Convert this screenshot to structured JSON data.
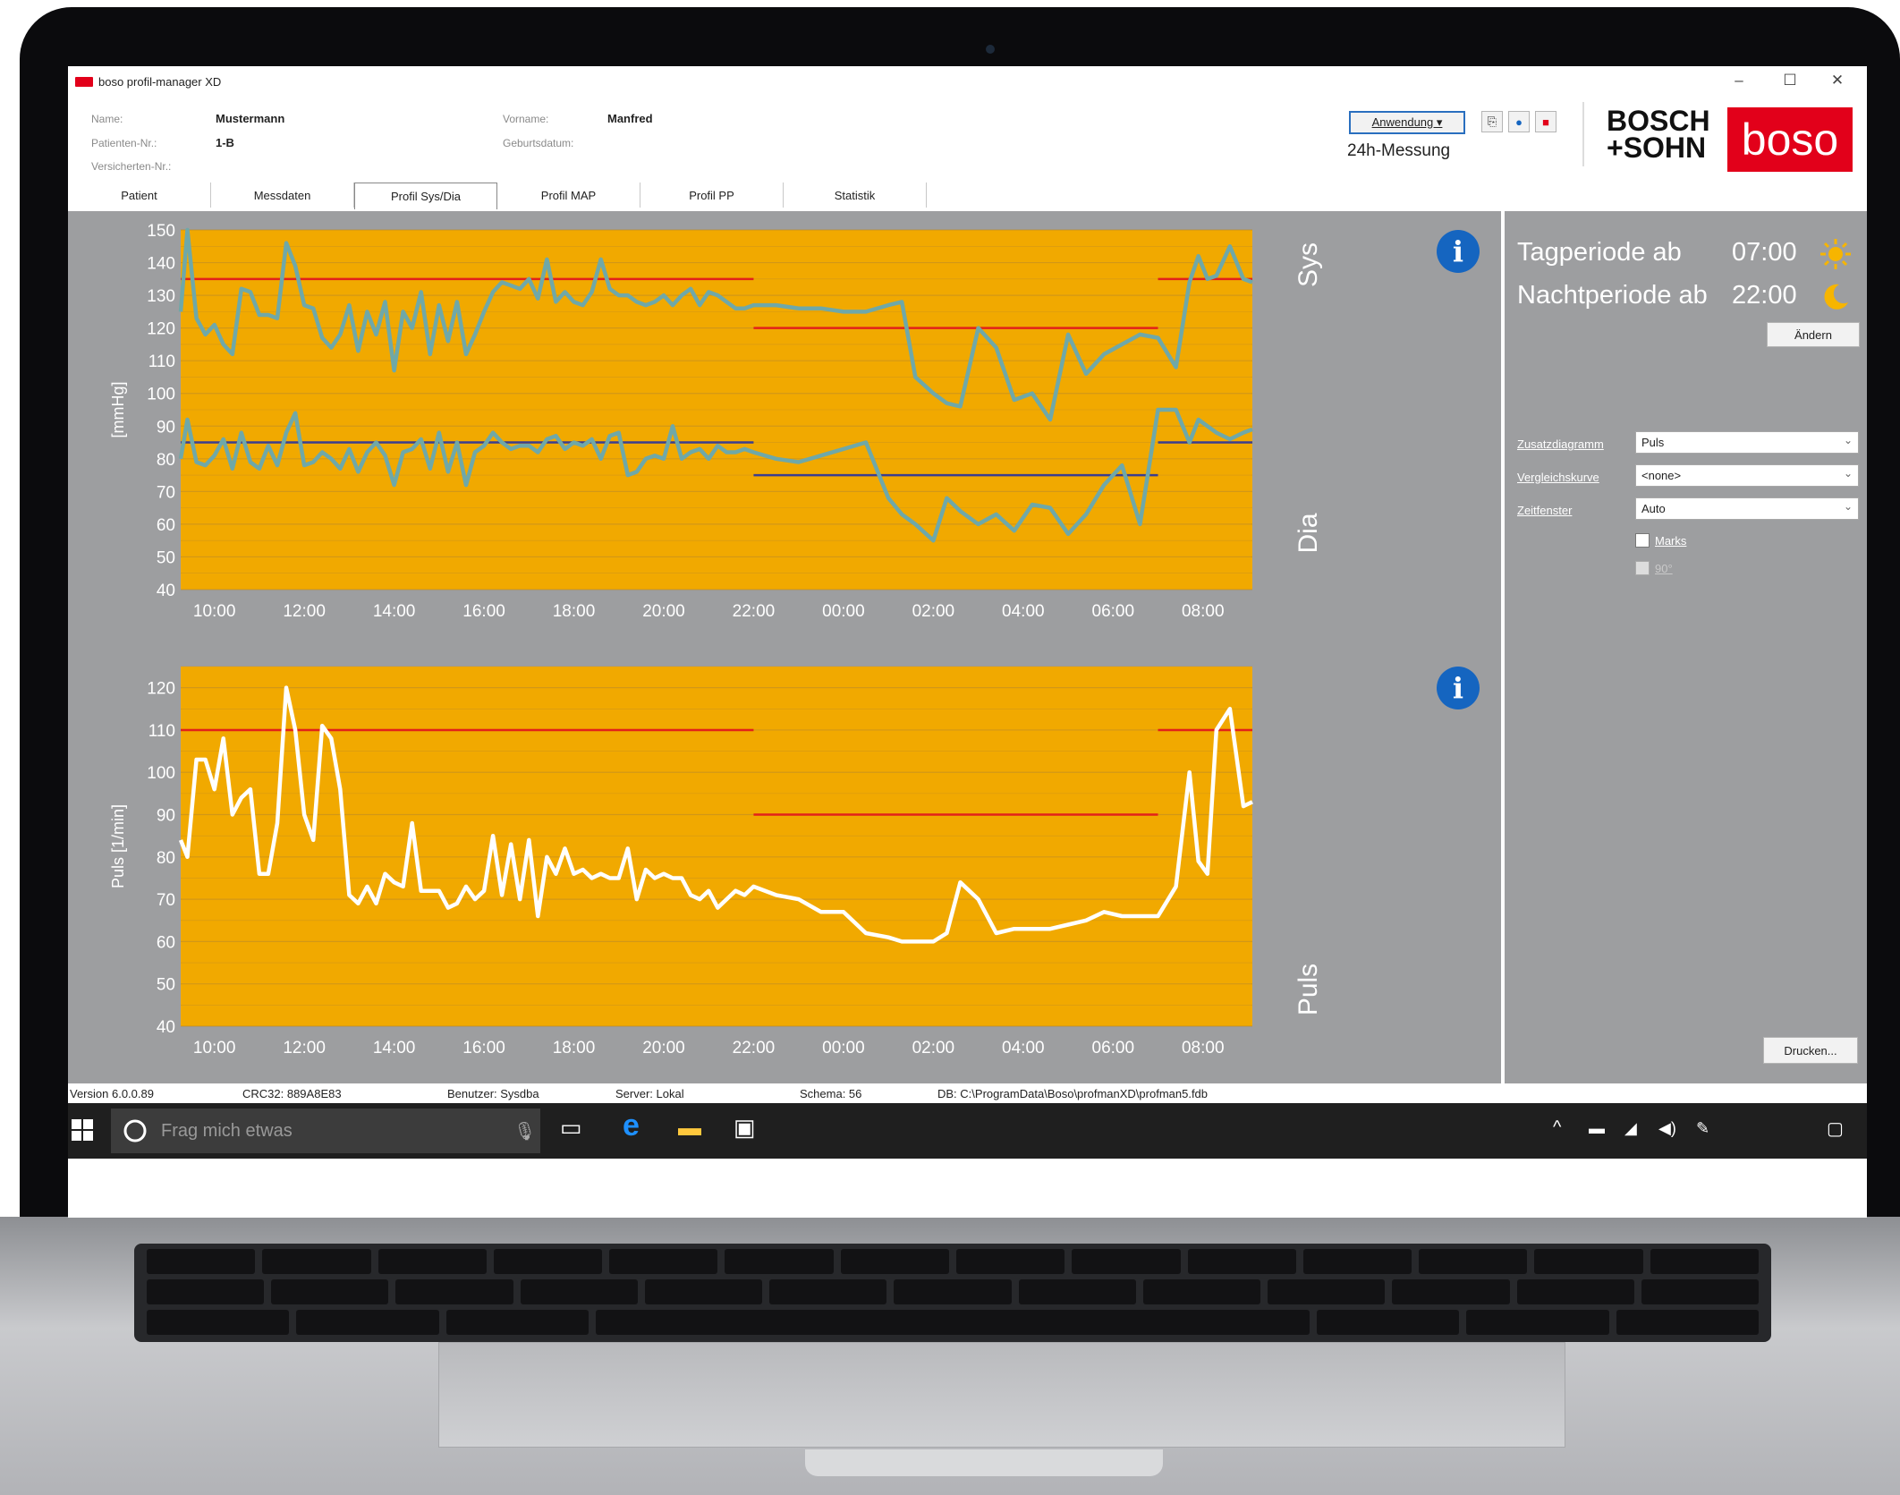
{
  "window": {
    "title": "boso profil-manager XD",
    "min": "–",
    "max": "☐",
    "close": "✕"
  },
  "patient": {
    "name_label": "Name:",
    "name_value": "Mustermann",
    "firstname_label": "Vorname:",
    "firstname_value": "Manfred",
    "patno_label": "Patienten-Nr.:",
    "patno_value": "1-B",
    "dob_label": "Geburtsdatum:",
    "insurance_label": "Versicherten-Nr.:"
  },
  "header": {
    "app_button": "Anwendung ▾",
    "mode": "24h-Messung",
    "brand_line1": "BOSCH",
    "brand_line2": "+SOHN",
    "boso_logo": "boso"
  },
  "tabs": [
    "Patient",
    "Messdaten",
    "Profil Sys/Dia",
    "Profil MAP",
    "Profil PP",
    "Statistik"
  ],
  "active_tab": "Profil Sys/Dia",
  "colors": {
    "chart_bg": "#f1a900",
    "sys_dia_line": "#6fa8a8",
    "pulse_line": "#ffffff",
    "limit_red": "#e2211a",
    "limit_blue": "#3b3e8f",
    "panel_grey": "#9d9ea0"
  },
  "side_labels": {
    "sys": "Sys",
    "dia": "Dia",
    "puls": "Puls"
  },
  "info_icon": "i",
  "right_panel": {
    "day_label": "Tagperiode ab",
    "day_time": "07:00",
    "night_label": "Nachtperiode ab",
    "night_time": "22:00",
    "change_button": "Ändern",
    "extra_chart_label": "Zusatzdiagramm",
    "extra_chart_value": "Puls",
    "compare_label": "Vergleichskurve",
    "compare_value": "<none>",
    "window_label": "Zeitfenster",
    "window_value": "Auto",
    "marks_label": "Marks",
    "deg_label": "90°",
    "print_button": "Drucken..."
  },
  "status": {
    "version": "Version 6.0.0.89",
    "crc": "CRC32: 889A8E83",
    "user": "Benutzer: Sysdba",
    "server": "Server: Lokal",
    "schema": "Schema: 56",
    "db": "DB: C:\\ProgramData\\Boso\\profmanXD\\profman5.fdb"
  },
  "taskbar": {
    "search_placeholder": "Frag mich etwas"
  },
  "chart_data": [
    {
      "type": "line",
      "ylabel": "[mmHg]",
      "ylim": [
        40,
        150
      ],
      "yticks": [
        40,
        50,
        60,
        70,
        80,
        90,
        100,
        110,
        120,
        130,
        140,
        150
      ],
      "x_ticks": [
        "10:00",
        "12:00",
        "14:00",
        "16:00",
        "18:00",
        "20:00",
        "22:00",
        "00:00",
        "02:00",
        "04:00",
        "06:00",
        "08:00"
      ],
      "x_hour_range": [
        9.25,
        33.1
      ],
      "series": [
        {
          "x": [
            9.25,
            9.4,
            9.6,
            9.8,
            10.0,
            10.2,
            10.4,
            10.6,
            10.8,
            11.0,
            11.2,
            11.4,
            11.6,
            11.8,
            12.0,
            12.2,
            12.4,
            12.6,
            12.8,
            13.0,
            13.2,
            13.4,
            13.6,
            13.8,
            14.0,
            14.2,
            14.4,
            14.6,
            14.8,
            15.0,
            15.2,
            15.4,
            15.6,
            15.8,
            16.0,
            16.2,
            16.4,
            16.6,
            16.8,
            17.0,
            17.2,
            17.4,
            17.6,
            17.8,
            18.0,
            18.2,
            18.4,
            18.6,
            18.8,
            19.0,
            19.2,
            19.4,
            19.6,
            19.8,
            20.0,
            20.2,
            20.4,
            20.6,
            20.8,
            21.0,
            21.2,
            21.4,
            21.6,
            21.8,
            22.0,
            22.5,
            23.0,
            23.5,
            24.0,
            24.5,
            25.0,
            25.3,
            25.6,
            26.0,
            26.3,
            26.6,
            27.0,
            27.4,
            27.8,
            28.2,
            28.6,
            29.0,
            29.4,
            29.8,
            30.2,
            30.6,
            31.0,
            31.4,
            31.7,
            31.9,
            32.1,
            32.3,
            32.6,
            32.9,
            33.1
          ],
          "values": [
            125,
            150,
            123,
            118,
            121,
            115,
            112,
            132,
            131,
            124,
            124,
            123,
            146,
            139,
            127,
            126,
            117,
            114,
            118,
            127,
            113,
            125,
            118,
            128,
            107,
            125,
            120,
            131,
            112,
            127,
            116,
            128,
            112,
            118,
            125,
            131,
            134,
            133,
            132,
            135,
            129,
            141,
            128,
            131,
            128,
            127,
            131,
            141,
            132,
            130,
            130,
            128,
            127,
            128,
            130,
            127,
            130,
            132,
            127,
            131,
            130,
            128,
            126,
            126,
            127,
            127,
            126,
            126,
            125,
            125,
            127,
            128,
            105,
            100,
            97,
            96,
            120,
            114,
            98,
            100,
            92,
            118,
            106,
            112,
            115,
            118,
            117,
            108,
            134,
            142,
            135,
            136,
            145,
            135,
            134
          ]
        },
        {
          "x": [
            9.25,
            9.4,
            9.6,
            9.8,
            10.0,
            10.2,
            10.4,
            10.6,
            10.8,
            11.0,
            11.2,
            11.4,
            11.6,
            11.8,
            12.0,
            12.2,
            12.4,
            12.6,
            12.8,
            13.0,
            13.2,
            13.4,
            13.6,
            13.8,
            14.0,
            14.2,
            14.4,
            14.6,
            14.8,
            15.0,
            15.2,
            15.4,
            15.6,
            15.8,
            16.0,
            16.2,
            16.4,
            16.6,
            16.8,
            17.0,
            17.2,
            17.4,
            17.6,
            17.8,
            18.0,
            18.2,
            18.4,
            18.6,
            18.8,
            19.0,
            19.2,
            19.4,
            19.6,
            19.8,
            20.0,
            20.2,
            20.4,
            20.6,
            20.8,
            21.0,
            21.2,
            21.4,
            21.6,
            21.8,
            22.0,
            22.5,
            23.0,
            23.5,
            24.0,
            24.5,
            25.0,
            25.3,
            25.6,
            26.0,
            26.3,
            26.6,
            27.0,
            27.4,
            27.8,
            28.2,
            28.6,
            29.0,
            29.4,
            29.8,
            30.2,
            30.6,
            31.0,
            31.4,
            31.7,
            31.9,
            32.1,
            32.3,
            32.6,
            32.9,
            33.1
          ],
          "values": [
            80,
            92,
            79,
            78,
            81,
            86,
            77,
            88,
            79,
            77,
            84,
            78,
            88,
            94,
            78,
            79,
            82,
            80,
            77,
            83,
            76,
            82,
            85,
            81,
            72,
            82,
            83,
            86,
            77,
            88,
            76,
            85,
            72,
            82,
            84,
            88,
            85,
            83,
            84,
            84,
            82,
            86,
            87,
            83,
            85,
            84,
            86,
            80,
            87,
            88,
            75,
            76,
            80,
            81,
            80,
            90,
            80,
            82,
            83,
            80,
            84,
            82,
            82,
            83,
            82,
            80,
            79,
            81,
            83,
            85,
            68,
            63,
            60,
            55,
            68,
            64,
            60,
            63,
            58,
            66,
            65,
            57,
            63,
            72,
            78,
            60,
            95,
            95,
            85,
            92,
            90,
            88,
            86,
            88,
            89
          ]
        }
      ],
      "limits": [
        {
          "from": 9.25,
          "to": 22.0,
          "value": 135,
          "color": "red"
        },
        {
          "from": 22.0,
          "to": 31.0,
          "value": 120,
          "color": "red"
        },
        {
          "from": 31.0,
          "to": 33.1,
          "value": 135,
          "color": "red"
        },
        {
          "from": 9.25,
          "to": 22.0,
          "value": 85,
          "color": "blue"
        },
        {
          "from": 22.0,
          "to": 31.0,
          "value": 75,
          "color": "blue"
        },
        {
          "from": 31.0,
          "to": 33.1,
          "value": 85,
          "color": "blue"
        }
      ]
    },
    {
      "type": "line",
      "ylabel": "Puls [1/min]",
      "ylim": [
        40,
        125
      ],
      "yticks": [
        40,
        50,
        60,
        70,
        80,
        90,
        100,
        110,
        120
      ],
      "x_ticks": [
        "10:00",
        "12:00",
        "14:00",
        "16:00",
        "18:00",
        "20:00",
        "22:00",
        "00:00",
        "02:00",
        "04:00",
        "06:00",
        "08:00"
      ],
      "x_hour_range": [
        9.25,
        33.1
      ],
      "series": [
        {
          "x": [
            9.25,
            9.4,
            9.6,
            9.8,
            10.0,
            10.2,
            10.4,
            10.6,
            10.8,
            11.0,
            11.2,
            11.4,
            11.6,
            11.8,
            12.0,
            12.2,
            12.4,
            12.6,
            12.8,
            13.0,
            13.2,
            13.4,
            13.6,
            13.8,
            14.0,
            14.2,
            14.4,
            14.6,
            14.8,
            15.0,
            15.2,
            15.4,
            15.6,
            15.8,
            16.0,
            16.2,
            16.4,
            16.6,
            16.8,
            17.0,
            17.2,
            17.4,
            17.6,
            17.8,
            18.0,
            18.2,
            18.4,
            18.6,
            18.8,
            19.0,
            19.2,
            19.4,
            19.6,
            19.8,
            20.0,
            20.2,
            20.4,
            20.6,
            20.8,
            21.0,
            21.2,
            21.4,
            21.6,
            21.8,
            22.0,
            22.5,
            23.0,
            23.5,
            24.0,
            24.5,
            25.0,
            25.3,
            25.6,
            26.0,
            26.3,
            26.6,
            27.0,
            27.4,
            27.8,
            28.2,
            28.6,
            29.0,
            29.4,
            29.8,
            30.2,
            30.6,
            31.0,
            31.4,
            31.7,
            31.9,
            32.1,
            32.3,
            32.6,
            32.9,
            33.1
          ],
          "values": [
            84,
            80,
            103,
            103,
            96,
            108,
            90,
            94,
            96,
            76,
            76,
            88,
            120,
            110,
            90,
            84,
            111,
            108,
            96,
            71,
            69,
            73,
            69,
            76,
            74,
            73,
            88,
            72,
            72,
            72,
            68,
            69,
            73,
            70,
            72,
            85,
            71,
            83,
            70,
            84,
            66,
            80,
            76,
            82,
            76,
            77,
            75,
            76,
            75,
            75,
            82,
            70,
            77,
            75,
            76,
            75,
            75,
            71,
            70,
            72,
            68,
            70,
            72,
            71,
            73,
            71,
            70,
            67,
            67,
            62,
            61,
            60,
            60,
            60,
            62,
            74,
            70,
            62,
            63,
            63,
            63,
            64,
            65,
            67,
            66,
            66,
            66,
            73,
            100,
            79,
            76,
            110,
            115,
            92,
            93
          ]
        }
      ],
      "limits": [
        {
          "from": 9.25,
          "to": 22.0,
          "value": 110,
          "color": "red"
        },
        {
          "from": 22.0,
          "to": 31.0,
          "value": 90,
          "color": "red"
        },
        {
          "from": 31.0,
          "to": 33.1,
          "value": 110,
          "color": "red"
        }
      ]
    }
  ]
}
